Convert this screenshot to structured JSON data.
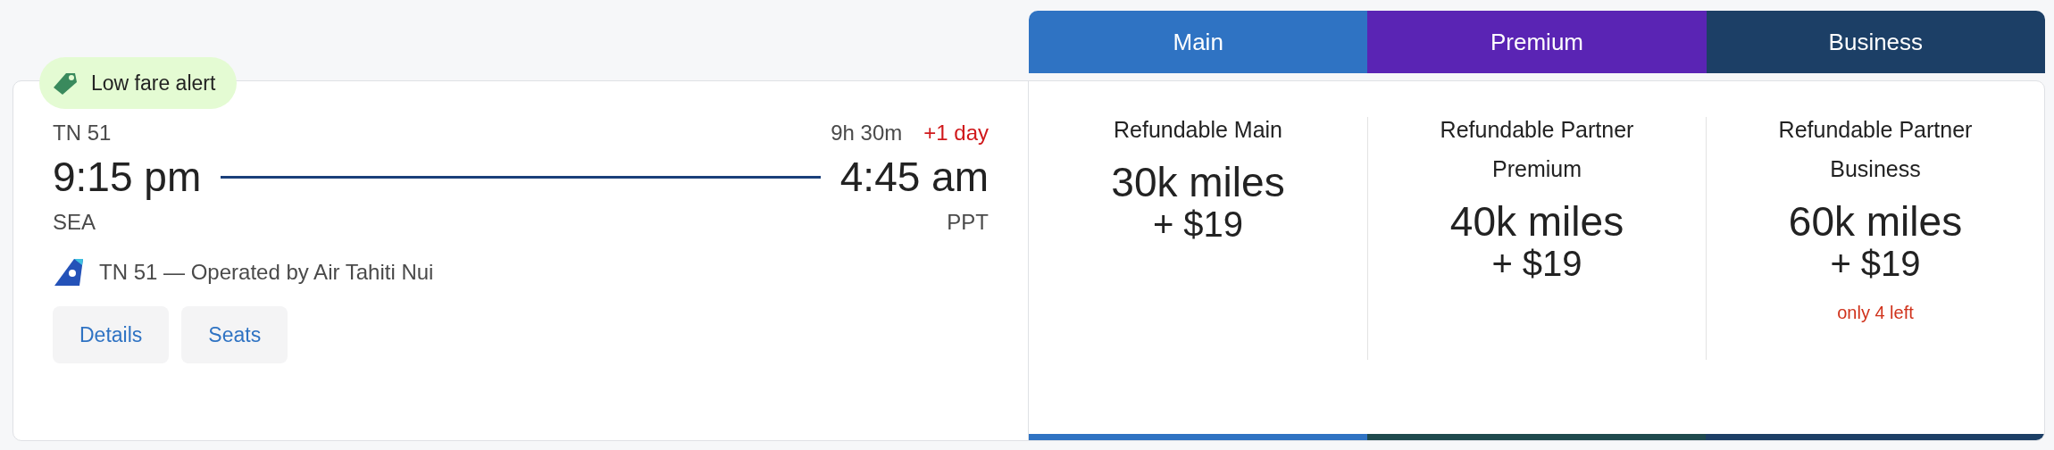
{
  "badge": {
    "label": "Low fare alert"
  },
  "flight": {
    "number": "TN 51",
    "duration": "9h 30m",
    "day_offset": "+1 day",
    "depart_time": "9:15 pm",
    "arrive_time": "4:45 am",
    "origin": "SEA",
    "destination": "PPT",
    "operator": "TN 51 — Operated by Air Tahiti Nui"
  },
  "buttons": [
    "Details",
    "Seats"
  ],
  "cabins": [
    {
      "label": "Main",
      "color": "#2f73c3"
    },
    {
      "label": "Premium",
      "color": "#5a24b4"
    },
    {
      "label": "Business",
      "color": "#1c3f66"
    }
  ],
  "fares": [
    {
      "name": "Refundable Main",
      "miles": "30k miles",
      "fee": "+ $19",
      "color": "#2f73c3"
    },
    {
      "name": "Refundable Partner Premium",
      "miles": "40k miles",
      "fee": "+ $19",
      "color": "#1f4a4e"
    },
    {
      "name": "Refundable Partner Business",
      "miles": "60k miles",
      "fee": "+ $19",
      "note": "only 4 left",
      "color": "#1c3f66"
    }
  ]
}
